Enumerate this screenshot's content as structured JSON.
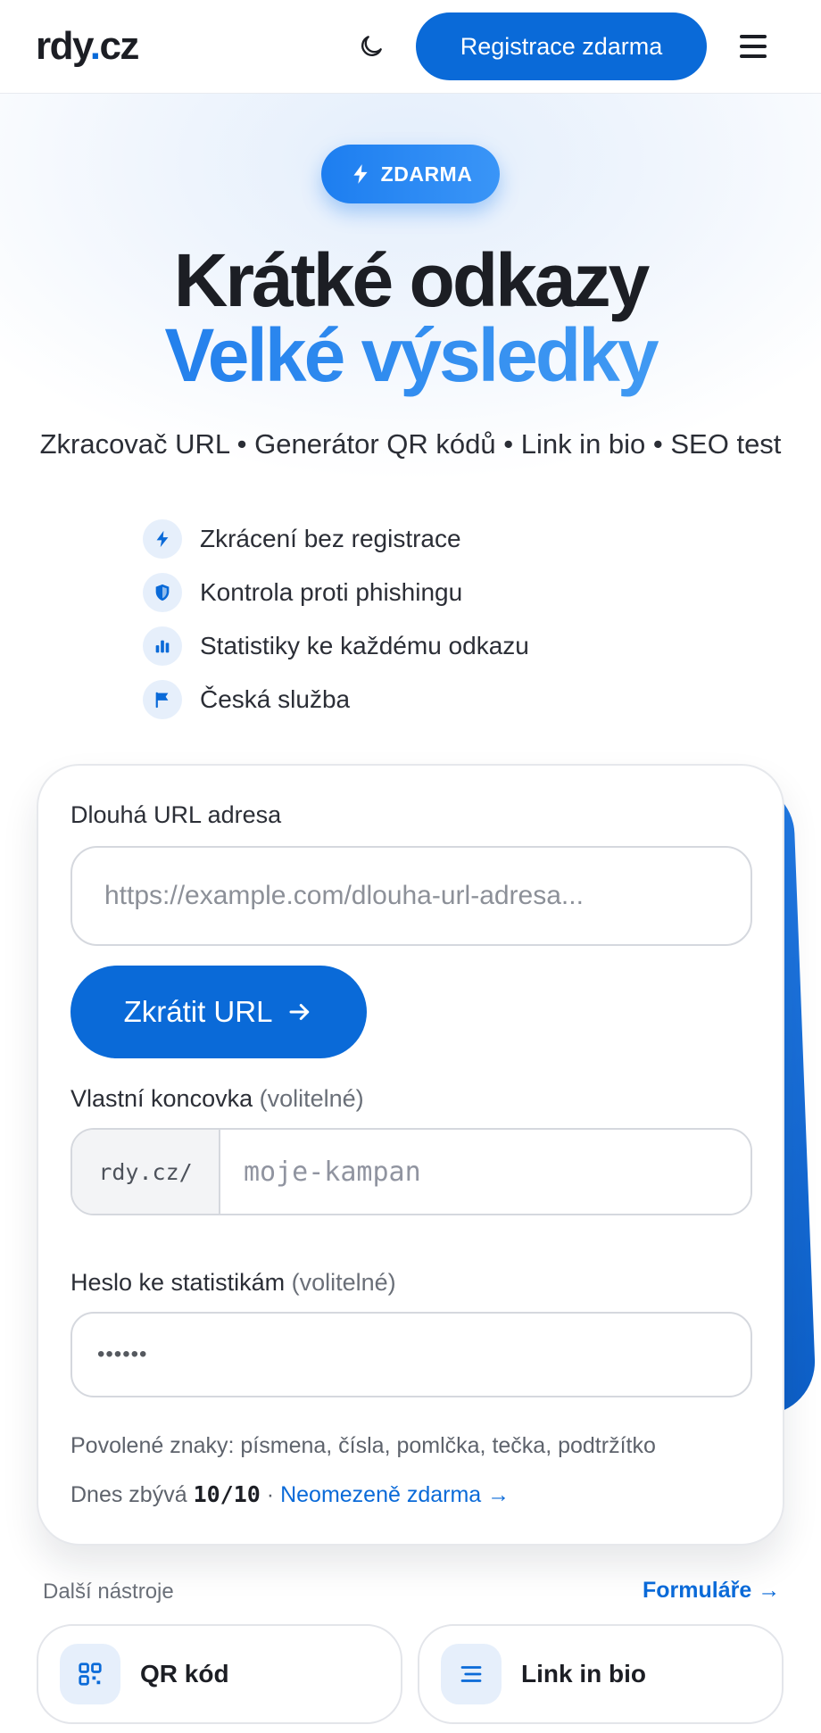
{
  "header": {
    "logo_main": "rdy",
    "logo_dot": ".",
    "logo_tld": "cz",
    "register_label": "Registrace zdarma"
  },
  "hero": {
    "badge": "ZDARMA",
    "title_line1": "Krátké odkazy",
    "title_line2": "Velké výsledky",
    "subtitle": "Zkracovač URL • Generátor QR kódů • Link in bio • SEO test",
    "features": [
      {
        "icon": "bolt-icon",
        "label": "Zkrácení bez registrace"
      },
      {
        "icon": "shield-icon",
        "label": "Kontrola proti phishingu"
      },
      {
        "icon": "bar-chart-icon",
        "label": "Statistiky ke každému odkazu"
      },
      {
        "icon": "flag-icon",
        "label": "Česká služba"
      }
    ]
  },
  "form": {
    "url_label": "Dlouhá URL adresa",
    "url_placeholder": "https://example.com/dlouha-url-adresa...",
    "shorten_label": "Zkrátit URL",
    "slug_label": "Vlastní koncovka",
    "slug_optional": "(volitelné)",
    "slug_prefix": "rdy.cz/",
    "slug_placeholder": "moje-kampan",
    "password_label": "Heslo ke statistikám",
    "password_optional": "(volitelné)",
    "password_placeholder": "••••••",
    "allowed_chars": "Povolené znaky: písmena, čísla, pomlčka, tečka, podtržítko",
    "quota_prefix": "Dnes zbývá",
    "quota_value": "10/10",
    "quota_sep": "·",
    "quota_link": "Neomezeně zdarma →"
  },
  "tools": {
    "label": "Další nástroje",
    "link": "Formuláře →",
    "items": [
      {
        "icon": "qr-code-icon",
        "label": "QR kód"
      },
      {
        "icon": "list-icon",
        "label": "Link in bio"
      }
    ]
  },
  "colors": {
    "accent": "#0a6ad8",
    "accent_light": "#3a95f7",
    "text": "#1c1e24",
    "muted": "#6a6f78"
  }
}
